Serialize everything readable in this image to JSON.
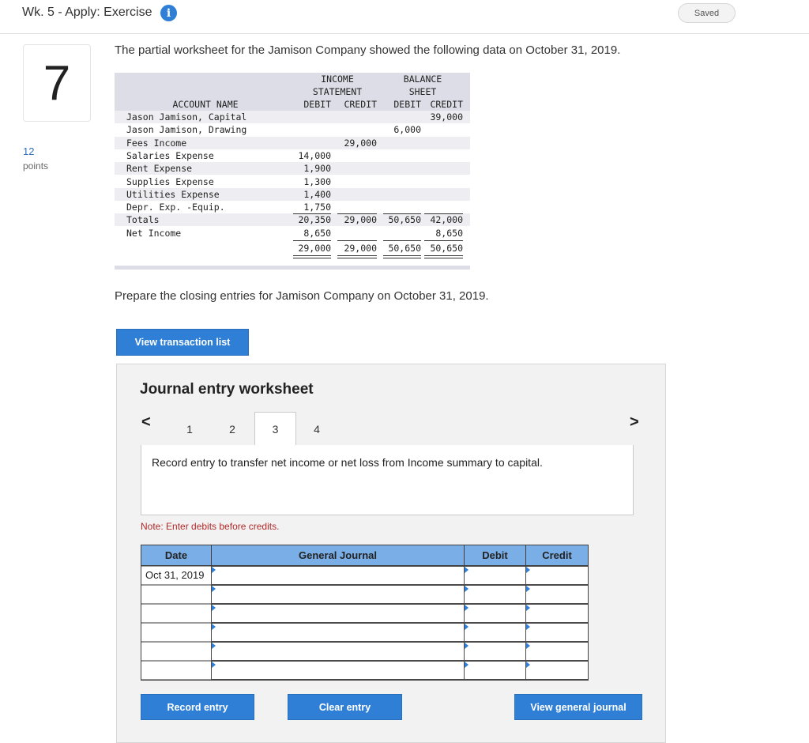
{
  "header": {
    "title": "Wk. 5 - Apply: Exercise",
    "info_icon": "info-icon",
    "saved": "Saved"
  },
  "question": {
    "number": "7",
    "points_value": "12",
    "points_label": "points"
  },
  "intro": "The partial worksheet for the Jamison Company showed the following data on October 31, 2019.",
  "worksheet": {
    "header": {
      "income_l1": "INCOME",
      "income_l2": "STATEMENT",
      "balance_l1": "BALANCE",
      "balance_l2": "SHEET",
      "account": "ACCOUNT NAME",
      "cols": [
        "DEBIT",
        "CREDIT",
        "DEBIT",
        "CREDIT"
      ]
    },
    "rows": [
      {
        "name": "Jason Jamison, Capital",
        "is_dr": "",
        "is_cr": "",
        "bs_dr": "",
        "bs_cr": "39,000"
      },
      {
        "name": "Jason Jamison, Drawing",
        "is_dr": "",
        "is_cr": "",
        "bs_dr": "6,000",
        "bs_cr": ""
      },
      {
        "name": "Fees Income",
        "is_dr": "",
        "is_cr": "29,000",
        "bs_dr": "",
        "bs_cr": ""
      },
      {
        "name": "Salaries Expense",
        "is_dr": "14,000",
        "is_cr": "",
        "bs_dr": "",
        "bs_cr": ""
      },
      {
        "name": "Rent Expense",
        "is_dr": "1,900",
        "is_cr": "",
        "bs_dr": "",
        "bs_cr": ""
      },
      {
        "name": "Supplies Expense",
        "is_dr": "1,300",
        "is_cr": "",
        "bs_dr": "",
        "bs_cr": ""
      },
      {
        "name": "Utilities Expense",
        "is_dr": "1,400",
        "is_cr": "",
        "bs_dr": "",
        "bs_cr": ""
      },
      {
        "name": "Depr. Exp. -Equip.",
        "is_dr": "1,750",
        "is_cr": "",
        "bs_dr": "",
        "bs_cr": ""
      },
      {
        "name": "Totals",
        "is_dr": "20,350",
        "is_cr": "29,000",
        "bs_dr": "50,650",
        "bs_cr": "42,000"
      },
      {
        "name": "Net Income",
        "is_dr": "8,650",
        "is_cr": "",
        "bs_dr": "",
        "bs_cr": "8,650"
      },
      {
        "name": "",
        "is_dr": "29,000",
        "is_cr": "29,000",
        "bs_dr": "50,650",
        "bs_cr": "50,650"
      }
    ]
  },
  "prepare": "Prepare the closing entries for Jamison Company on October 31, 2019.",
  "buttons": {
    "view_transactions": "View transaction list",
    "record": "Record entry",
    "clear": "Clear entry",
    "view_journal": "View general journal"
  },
  "journal": {
    "title": "Journal entry worksheet",
    "tabs": [
      "1",
      "2",
      "3",
      "4"
    ],
    "active_tab": "3",
    "instruction": "Record entry to transfer net income or net loss from Income summary to capital.",
    "note": "Note: Enter debits before credits.",
    "columns": {
      "date": "Date",
      "general_journal": "General Journal",
      "debit": "Debit",
      "credit": "Credit"
    },
    "rows": [
      {
        "date": "Oct 31, 2019"
      },
      {
        "date": ""
      },
      {
        "date": ""
      },
      {
        "date": ""
      },
      {
        "date": ""
      },
      {
        "date": ""
      }
    ]
  }
}
